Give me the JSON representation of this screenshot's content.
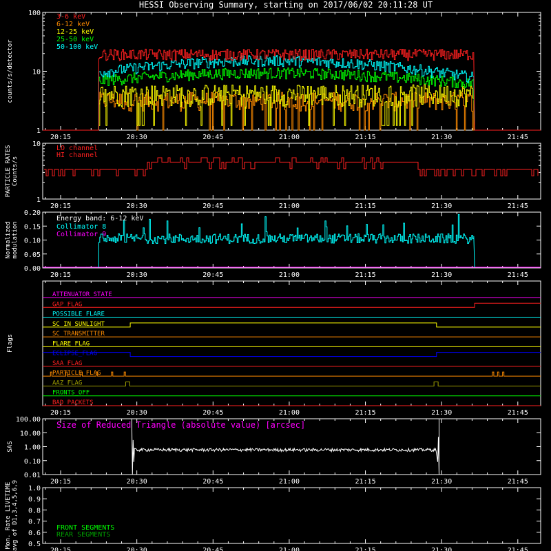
{
  "title": "HESSI Observing Summary, starting on 2017/06/02 20:11:28 UT",
  "colors": {
    "background": "#000000",
    "axes": "#ffffff",
    "red": "#ff2020",
    "orange": "#ff8c00",
    "yellow": "#ffff00",
    "green": "#00ff00",
    "cyan": "#00ffff",
    "magenta": "#ff00ff",
    "blue": "#0000ff",
    "olive": "#a0a000",
    "darkgreen": "#00a000"
  },
  "time_axis": {
    "ticks": [
      "20:15",
      "20:30",
      "20:45",
      "21:00",
      "21:15",
      "21:30",
      "21:45"
    ],
    "start_min": 11.47,
    "end_min": 60,
    "tick_mins": [
      15,
      30,
      45,
      60,
      75,
      90,
      105
    ]
  },
  "chart_data": [
    {
      "type": "line",
      "panel": "counts",
      "ylabel": "counts/s/detector",
      "yscale": "log",
      "ylim": [
        1,
        100
      ],
      "y_ticks": [
        "1",
        "10",
        "100"
      ],
      "x_range_min": [
        11.47,
        109.5
      ],
      "data_window_min": [
        22.5,
        96.5
      ],
      "series": [
        {
          "name": "3-6 keV",
          "color": "#ff2020",
          "level": 19
        },
        {
          "name": "6-12 keV",
          "color": "#ff8c00",
          "level": 2.6
        },
        {
          "name": "12-25 keV",
          "color": "#ffff00",
          "level": 3.5
        },
        {
          "name": "25-50 keV",
          "color": "#00ff00",
          "level": 8
        },
        {
          "name": "50-100 keV",
          "color": "#00ffff",
          "level": 11
        }
      ]
    },
    {
      "type": "line",
      "panel": "particle",
      "ylabel": "PARTICLE RATES\nCounts/s",
      "yscale": "log",
      "ylim": [
        1,
        10
      ],
      "y_ticks": [
        "1",
        "10"
      ],
      "series": [
        {
          "name": "LO channel",
          "color": "#ff2020",
          "level": 3.5
        },
        {
          "name": "HI channel",
          "color": "#ff2020",
          "level": 3.5
        }
      ]
    },
    {
      "type": "line",
      "panel": "modulation",
      "ylabel": "Normalized\nmodulation",
      "ylim": [
        0,
        0.2
      ],
      "y_ticks": [
        "0.00",
        "0.05",
        "0.10",
        "0.15",
        "0.20"
      ],
      "annotation": "Energy band: 6-12 keV",
      "series": [
        {
          "name": "Collimator 8",
          "color": "#00ffff",
          "level": 0.105
        },
        {
          "name": "Collimator 9",
          "color": "#ff00ff",
          "level": 0
        }
      ]
    },
    {
      "type": "line",
      "panel": "flags",
      "ylabel": "Flags",
      "series": [
        {
          "name": "ATTENUATOR_STATE",
          "color": "#ff00ff"
        },
        {
          "name": "GAP_FLAG",
          "color": "#ff2020"
        },
        {
          "name": "POSSIBLE_FLARE",
          "color": "#00ffff"
        },
        {
          "name": "SC_IN_SUNLIGHT",
          "color": "#ffff00"
        },
        {
          "name": "SC_TRANSMITTER",
          "color": "#ff8c00"
        },
        {
          "name": "FLARE_FLAG",
          "color": "#ffff00"
        },
        {
          "name": "ECLIPSE_FLAG",
          "color": "#0000ff"
        },
        {
          "name": "SAA_FLAG",
          "color": "#ff2020"
        },
        {
          "name": "PARTICLE_FLAG",
          "color": "#ff8c00"
        },
        {
          "name": "AAZ_FLAG",
          "color": "#a0a000"
        },
        {
          "name": "FRONTS_OFF",
          "color": "#00ff00"
        },
        {
          "name": "BAD_PACKETS",
          "color": "#ff2020"
        }
      ]
    },
    {
      "type": "line",
      "panel": "sas",
      "ylabel": "SAS",
      "yscale": "log",
      "ylim": [
        0.01,
        100
      ],
      "y_ticks": [
        "0.01",
        "0.10",
        "1.00",
        "10.00",
        "100.00"
      ],
      "annotation": "Size of Reduced Triangle (absolute value) [arcsec]",
      "series": [
        {
          "name": "Size of Reduced Triangle",
          "color": "#ffffff",
          "level": 0.6,
          "window_min": [
            29,
            89.5
          ]
        }
      ]
    },
    {
      "type": "line",
      "panel": "livetime",
      "ylabel": "Mon. Rate LIVETIME\navg of D1,3,4,5,6,9",
      "ylim": [
        0.5,
        1.0
      ],
      "y_ticks": [
        "0.5",
        "0.6",
        "0.7",
        "0.8",
        "0.9",
        "1.0"
      ],
      "series": [
        {
          "name": "FRONT SEGMENTS",
          "color": "#00ff00"
        },
        {
          "name": "REAR SEGMENTS",
          "color": "#00a000"
        }
      ]
    }
  ]
}
